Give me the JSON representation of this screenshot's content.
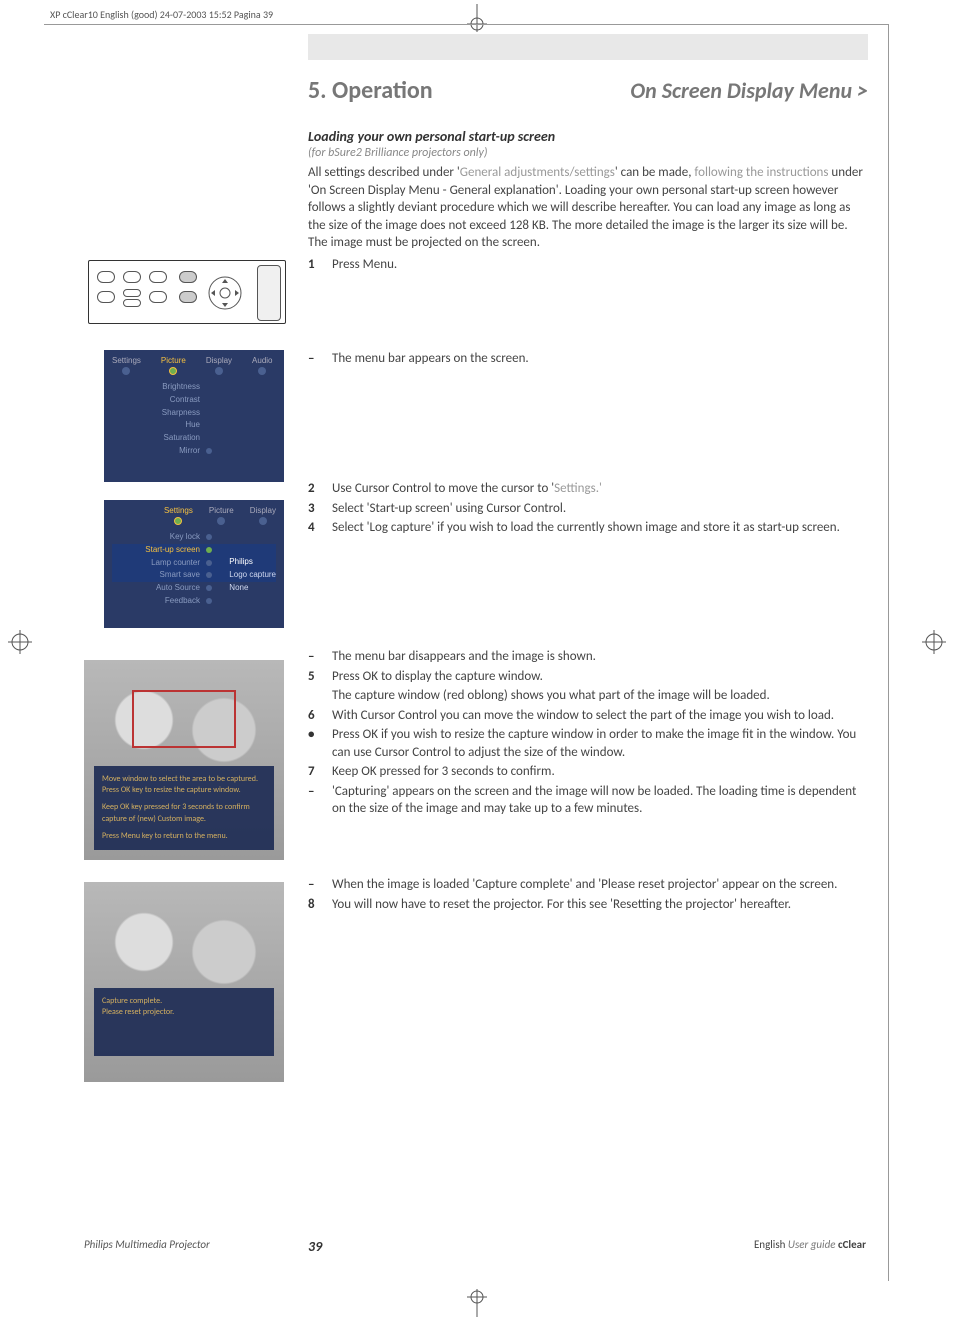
{
  "slug": "XP cClear10 English (good)  24-07-2003  15:52  Pagina 39",
  "chapter": {
    "num_title": "5. Operation",
    "subtitle": "On Screen Display Menu >"
  },
  "section": {
    "heading": "Loading your own personal start-up screen",
    "note": "(for bSure2 Brilliance projectors only)"
  },
  "intro": {
    "p1a": "All settings described under '",
    "p1b": "General adjustments/settings",
    "p1c": "' can be made, ",
    "p1d": "following the instructions",
    "p1e": " under 'On Screen Display Menu - General explanation'. Loading your own personal start-up screen however follows a slightly deviant procedure which we will describe hereafter. You can load any image as long as the size of the image does not exceed 128 KB. The more detailed the image is the larger its size will be. The image must be projected on the screen."
  },
  "steps": {
    "s1": "Press Menu.",
    "d1": "The menu bar appears on the screen.",
    "s2a": "Use Cursor Control to move the cursor to '",
    "s2b": "Settings.'",
    "s3": "Select 'Start-up screen' using Cursor Control.",
    "s4": "Select 'Log capture' if you wish to load the currently shown image and store it as start-up screen.",
    "d4": "The menu bar disappears and the image is shown.",
    "s5": "Press OK to display the capture window.",
    "s5b": "The capture window (red oblong) shows you what part of the image will be loaded.",
    "s6": "With Cursor Control you can move the window to select the part of the image you wish to load.",
    "b6": "Press OK if you wish to resize the capture window in order to make the image fit in the window. You can use Cursor Control to adjust the size of the window.",
    "s7": "Keep OK pressed for 3 seconds to confirm.",
    "d7": "'Capturing' appears on the screen and the image will now be loaded. The loading time is dependent on the size of the image and may take up to a few minutes.",
    "d8": "When the image is loaded 'Capture complete' and 'Please reset projector' appear on the screen.",
    "s8": "You will now have to reset the projector. For this see 'Resetting the projector' hereafter."
  },
  "numerals": {
    "n1": "1",
    "n2": "2",
    "n3": "3",
    "n4": "4",
    "n5": "5",
    "n6": "6",
    "n7": "7",
    "n8": "8",
    "dash": "–",
    "bullet": "•"
  },
  "osd1": {
    "tabs": [
      "Settings",
      "Picture",
      "Display",
      "Audio"
    ],
    "items": [
      "Brightness",
      "Contrast",
      "Sharpness",
      "Hue",
      "Saturation",
      "Mirror"
    ]
  },
  "osd2": {
    "tabs": [
      "Settings",
      "Picture",
      "Display"
    ],
    "items": [
      "Key lock",
      "Start-up screen",
      "Lamp counter",
      "Smart save",
      "Auto Source",
      "Feedback"
    ],
    "submenu": [
      "Philips",
      "Logo capture",
      "None"
    ]
  },
  "capture_overlay": {
    "l1": "Move window to select the area to be captured.",
    "l2": "Press OK key to resize the capture window.",
    "l3": "Keep OK key pressed for 3 seconds to confirm capture of (new) Custom image.",
    "l4": "Press Menu key to return to the menu."
  },
  "complete_overlay": {
    "l1": "Capture complete.",
    "l2": "Please reset projector."
  },
  "footer": {
    "left": "Philips Multimedia Projector",
    "page": "39",
    "right_a": "English ",
    "right_b": "User guide  ",
    "right_c": "cClear"
  }
}
